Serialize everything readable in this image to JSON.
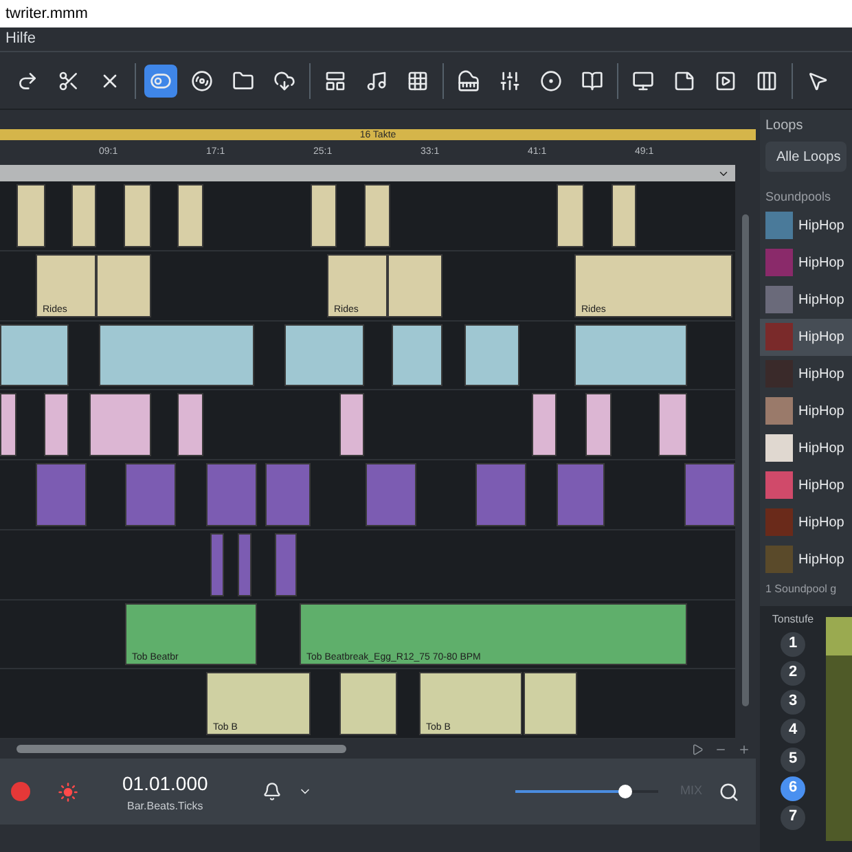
{
  "window": {
    "title": "twriter.mmm"
  },
  "menu": [
    "Hilfe"
  ],
  "toolbar_buttons": [
    {
      "kind": "redo",
      "selected": false
    },
    {
      "kind": "cut",
      "selected": false
    },
    {
      "kind": "delete",
      "selected": false
    },
    {
      "kind": "toggle",
      "selected": true
    },
    {
      "kind": "disc",
      "selected": false
    },
    {
      "kind": "folder",
      "selected": false
    },
    {
      "kind": "cloud",
      "selected": false
    },
    {
      "kind": "layout",
      "selected": false
    },
    {
      "kind": "music",
      "selected": false
    },
    {
      "kind": "grid",
      "selected": false
    },
    {
      "kind": "piano",
      "selected": false
    },
    {
      "kind": "mixer",
      "selected": false
    },
    {
      "kind": "fx",
      "selected": false
    },
    {
      "kind": "book",
      "selected": false
    },
    {
      "kind": "monitor",
      "selected": false
    },
    {
      "kind": "note",
      "selected": false
    },
    {
      "kind": "play",
      "selected": false
    },
    {
      "kind": "columns",
      "selected": false
    },
    {
      "kind": "pointer",
      "selected": false
    }
  ],
  "arranger": {
    "range_label": "16 Takte",
    "ruler": [
      "09:1",
      "17:1",
      "25:1",
      "33:1",
      "41:1",
      "49:1"
    ],
    "tracks": [
      {
        "kind": "sand"
      },
      {
        "kind": "sand",
        "labels": [
          "Rides",
          "Rides",
          "Rides"
        ]
      },
      {
        "kind": "ice"
      },
      {
        "kind": "rose"
      },
      {
        "kind": "violet"
      },
      {
        "kind": "violet"
      },
      {
        "kind": "green",
        "labels": [
          "Tob Beatbr",
          "Tob Beatbreak_Egg_R12_75 70-80 BPM"
        ]
      },
      {
        "kind": "olive",
        "labels": [
          "Tob B",
          "Tob B"
        ]
      }
    ]
  },
  "loops": {
    "title": "Loops",
    "filter": "Alle Loops",
    "section": "Soundpools",
    "items": [
      {
        "name": "HipHop",
        "selected": false
      },
      {
        "name": "HipHop",
        "selected": false
      },
      {
        "name": "HipHop",
        "selected": false
      },
      {
        "name": "HipHop",
        "selected": true
      },
      {
        "name": "HipHop",
        "selected": false
      },
      {
        "name": "HipHop",
        "selected": false
      },
      {
        "name": "HipHop",
        "selected": false
      },
      {
        "name": "HipHop",
        "selected": false
      },
      {
        "name": "HipHop",
        "selected": false
      },
      {
        "name": "HipHop",
        "selected": false
      }
    ],
    "footer": "1 Soundpool g"
  },
  "pitch": {
    "title": "Tonstufe",
    "steps": [
      {
        "label": "1",
        "selected": false
      },
      {
        "label": "2",
        "selected": false
      },
      {
        "label": "3",
        "selected": false
      },
      {
        "label": "4",
        "selected": false
      },
      {
        "label": "5",
        "selected": false
      },
      {
        "label": "6",
        "selected": true
      },
      {
        "label": "7",
        "selected": false
      }
    ]
  },
  "transport": {
    "time": "01.01.000",
    "time_format": "Bar.Beats.Ticks",
    "volume": {
      "level": 0.77
    },
    "mix_label": "MIX"
  }
}
